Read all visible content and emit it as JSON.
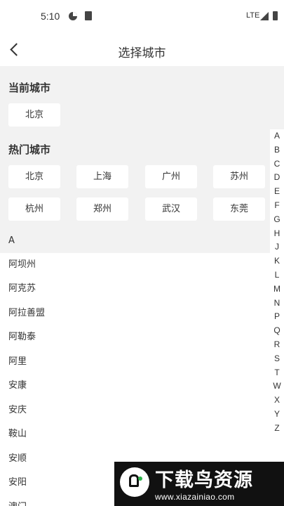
{
  "status_bar": {
    "time": "5:10",
    "network": "LTE",
    "icons": [
      "sync-icon",
      "sim-card-icon",
      "signal-icon",
      "battery-icon"
    ]
  },
  "header": {
    "title": "选择城市",
    "back_icon": "chevron-left-icon"
  },
  "current_city": {
    "title": "当前城市",
    "city": "北京"
  },
  "hot_cities": {
    "title": "热门城市",
    "cities": [
      "北京",
      "上海",
      "广州",
      "苏州",
      "杭州",
      "郑州",
      "武汉",
      "东莞"
    ]
  },
  "city_list": {
    "letter": "A",
    "cities": [
      "阿坝州",
      "阿克苏",
      "阿拉善盟",
      "阿勒泰",
      "阿里",
      "安康",
      "安庆",
      "鞍山",
      "安顺",
      "安阳",
      "澳门"
    ]
  },
  "index_letters": [
    "A",
    "B",
    "C",
    "D",
    "E",
    "F",
    "G",
    "H",
    "J",
    "K",
    "L",
    "M",
    "N",
    "P",
    "Q",
    "R",
    "S",
    "T",
    "W",
    "X",
    "Y",
    "Z"
  ],
  "watermark": {
    "title": "下载鸟资源",
    "url": "www.xiazainiao.com",
    "accent": "#2db34a"
  }
}
